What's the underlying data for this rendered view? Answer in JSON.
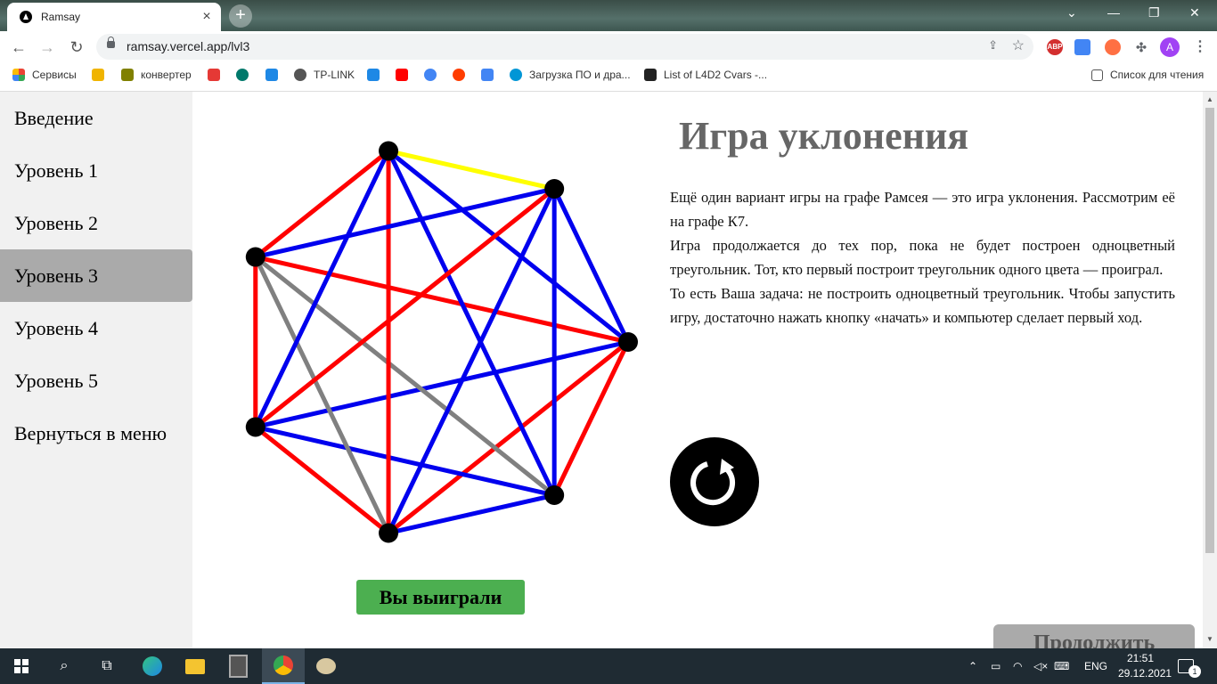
{
  "browser": {
    "tab_title": "Ramsay",
    "tab_close": "×",
    "new_tab": "+",
    "url": "ramsay.vercel.app/lvl3",
    "bookmarks": [
      {
        "label": "Сервисы",
        "color": "#e0a000"
      },
      {
        "label": "",
        "color": "#f0b400"
      },
      {
        "label": "конвертер",
        "color": "#808000"
      },
      {
        "label": "",
        "color": "#e53935"
      },
      {
        "label": "",
        "color": "#00796b"
      },
      {
        "label": "",
        "color": "#1e88e5"
      },
      {
        "label": "TP-LINK",
        "color": "#555555"
      },
      {
        "label": "",
        "color": "#1e88e5"
      },
      {
        "label": "",
        "color": "#ff0000"
      },
      {
        "label": "",
        "color": "#4285f4"
      },
      {
        "label": "",
        "color": "#ff3d00"
      },
      {
        "label": "",
        "color": "#4285f4"
      },
      {
        "label": "Загрузка ПО и дра...",
        "color": "#0096d6"
      },
      {
        "label": "List of L4D2 Cvars -...",
        "color": "#222222"
      }
    ],
    "reading_list": "Список для чтения",
    "profile_initial": "A",
    "abp": "ABP"
  },
  "sidebar": {
    "items": [
      {
        "label": "Введение",
        "active": false
      },
      {
        "label": "Уровень 1",
        "active": false
      },
      {
        "label": "Уровень 2",
        "active": false
      },
      {
        "label": "Уровень 3",
        "active": true
      },
      {
        "label": "Уровень 4",
        "active": false
      },
      {
        "label": "Уровень 5",
        "active": false
      },
      {
        "label": "Вернуться в меню",
        "active": false
      }
    ]
  },
  "main": {
    "title": "Игра уклонения",
    "paragraphs": [
      "Ещё один вариант игры на графе Рамсея — это игра уклонения. Рассмотрим её на графе К7.",
      "Игра продолжается до тех пор, пока не будет построен одноцветный треугольник. Тот, кто первый построит треугольник одного цвета — проиграл.",
      "То есть Ваша задача: не построить одноцветный треугольник. Чтобы запустить игру, достаточно нажать кнопку «начать» и компьютер сделает первый ход."
    ],
    "result_label": "Вы выиграли",
    "continue_label": "Продолжить"
  },
  "graph": {
    "vertex_count": 7,
    "colors": {
      "red": "#ff0000",
      "blue": "#0000ee",
      "gray": "#808080",
      "yellow": "#ffff00",
      "vertex": "#000000"
    },
    "edges": [
      [
        0,
        1,
        "red"
      ],
      [
        0,
        2,
        "red"
      ],
      [
        0,
        3,
        "blue"
      ],
      [
        0,
        4,
        "red"
      ],
      [
        0,
        5,
        "blue"
      ],
      [
        0,
        6,
        "blue"
      ],
      [
        1,
        2,
        "blue"
      ],
      [
        1,
        3,
        "blue"
      ],
      [
        1,
        4,
        "gray"
      ],
      [
        1,
        5,
        "blue"
      ],
      [
        1,
        6,
        "blue"
      ],
      [
        2,
        3,
        "red"
      ],
      [
        2,
        4,
        "gray"
      ],
      [
        2,
        5,
        "red"
      ],
      [
        2,
        6,
        "blue"
      ],
      [
        3,
        4,
        "red"
      ],
      [
        3,
        5,
        "blue"
      ],
      [
        3,
        6,
        "red"
      ],
      [
        4,
        5,
        "red"
      ],
      [
        4,
        6,
        "blue"
      ],
      [
        5,
        6,
        "yellow"
      ]
    ]
  },
  "taskbar": {
    "language": "ENG",
    "time": "21:51",
    "date": "29.12.2021",
    "notification_count": "1"
  }
}
